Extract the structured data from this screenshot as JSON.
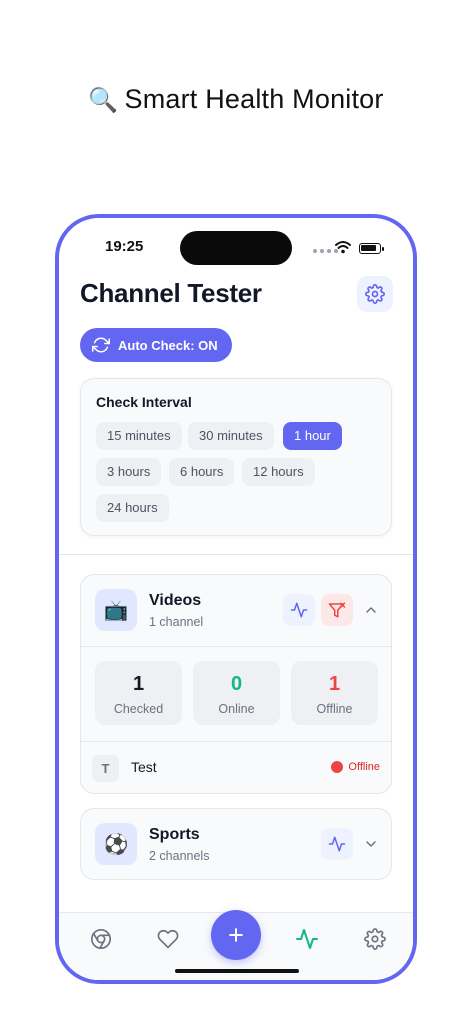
{
  "headline": {
    "emoji": "🔍",
    "text": "Smart Health Monitor"
  },
  "status_bar": {
    "time": "19:25"
  },
  "header": {
    "title": "Channel Tester"
  },
  "auto_check": {
    "label": "Auto Check: ON"
  },
  "interval": {
    "title": "Check Interval",
    "options": [
      "15 minutes",
      "30 minutes",
      "1 hour",
      "3 hours",
      "6 hours",
      "12 hours",
      "24 hours"
    ],
    "selected": "1 hour"
  },
  "groups": [
    {
      "icon": "📺",
      "name": "Videos",
      "count": "1 channel",
      "expanded": true,
      "stats": [
        {
          "value": "1",
          "label": "Checked",
          "color": "#111827"
        },
        {
          "value": "0",
          "label": "Online",
          "color": "#10b981"
        },
        {
          "value": "1",
          "label": "Offline",
          "color": "#ef4444"
        }
      ],
      "channels": [
        {
          "avatar": "T",
          "name": "Test",
          "status": "Offline"
        }
      ]
    },
    {
      "icon": "⚽",
      "name": "Sports",
      "count": "2 channels",
      "expanded": false
    }
  ],
  "tabbar": {
    "items": [
      "browser-icon",
      "heart-icon",
      "plus-icon",
      "activity-icon",
      "gear-icon"
    ],
    "active": "activity-icon"
  },
  "colors": {
    "accent": "#6366f1",
    "online": "#10b981",
    "offline": "#ef4444"
  }
}
